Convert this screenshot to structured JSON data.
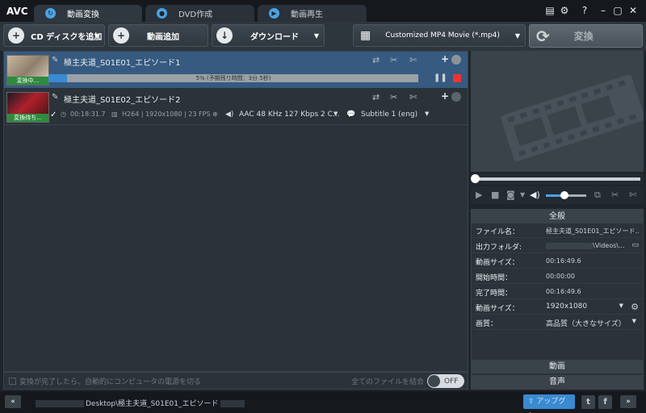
{
  "app": {
    "logo": "AVC"
  },
  "tabs": [
    {
      "label": "動画変換",
      "icon": "convert-tab-icon"
    },
    {
      "label": "DVD作成",
      "icon": "disc-tab-icon"
    },
    {
      "label": "動画再生",
      "icon": "play-tab-icon"
    }
  ],
  "window": {
    "help": "?"
  },
  "toolbar": {
    "add_cd": "CD ディスクを追加",
    "add_video": "動画追加",
    "download": "ダウンロード",
    "profile": "Customized MP4 Movie (*.mp4)",
    "convert": "変換"
  },
  "files": [
    {
      "name": "極主夫道_S01E01_エピソード1",
      "status": "変換中...",
      "progress_text": "5% (予期残り時間：3分 5秒)",
      "progress": 0.05
    },
    {
      "name": "極主夫道_S01E02_エピソード2",
      "status": "変換待ち...",
      "duration": "00:18:31.7",
      "video_info": "H264 | 1920x1080 | 23 FPS",
      "audio": "AAC 48 KHz 127 Kbps 2 C...",
      "subtitle": "Subtitle 1 (eng)"
    }
  ],
  "list_footer": {
    "auto_shutdown": "変換が完了したら、自動的にコンピュータの電源を切る",
    "merge": "全てのファイルを結合",
    "toggle": "OFF"
  },
  "player": {
    "volume": 0.45
  },
  "properties": {
    "header": "全般",
    "rows": [
      {
        "key": "ファイル名：",
        "value": "極主夫道_S01E01_エピソード..."
      },
      {
        "key": "出力フォルダ:",
        "value": "\\Videos\\..."
      },
      {
        "key": "動画サイズ：",
        "value": "00:16:49.6"
      },
      {
        "key": "開始時間：",
        "value": "00:00:00"
      },
      {
        "key": "完了時間：",
        "value": "00:16:49.6"
      },
      {
        "key": "動画サイズ：",
        "value": "1920x1080"
      },
      {
        "key": "画質：",
        "value": "高品質（大きなサイズ）"
      }
    ],
    "video_section": "動画",
    "audio_section": "音声"
  },
  "statusbar": {
    "path": "Desktop\\極主夫道_S01E01_エピソード",
    "upgrade": "アップグレ..."
  }
}
